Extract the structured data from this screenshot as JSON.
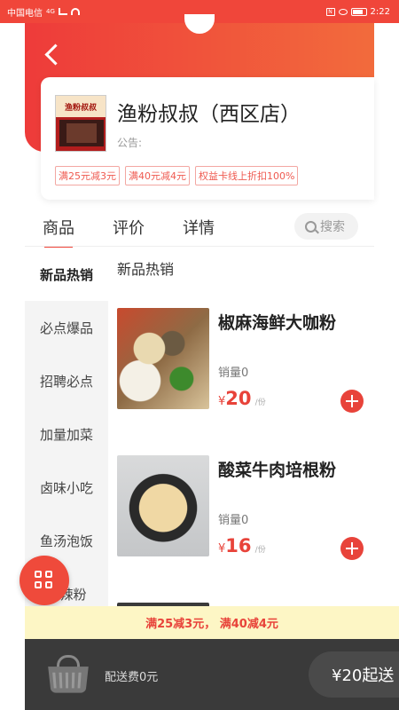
{
  "status_bar": {
    "carrier": "中国电信",
    "network": "4G",
    "time": "2:22"
  },
  "shop": {
    "name": "渔粉叔叔（西区店）",
    "notice_label": "公告:",
    "logo_sign": "渔粉叔叔",
    "promotions": [
      "满25元减3元",
      "满40元减4元",
      "权益卡线上折扣100%"
    ]
  },
  "tabs": {
    "items": [
      "商品",
      "评价",
      "详情"
    ],
    "active": "商品"
  },
  "search": {
    "placeholder": "搜索",
    "icon": "search-icon"
  },
  "categories": {
    "items": [
      "新品热销",
      "必点爆品",
      "招聘必点",
      "加量加菜",
      "卤味小吃",
      "鱼汤泡饭",
      "麻辣粉"
    ],
    "active": "新品热销"
  },
  "section_title": "新品热销",
  "products": [
    {
      "name": "椒麻海鲜大咖粉",
      "sales": "销量0",
      "currency": "¥",
      "price": "20",
      "unit": "/份"
    },
    {
      "name": "酸菜牛肉培根粉",
      "sales": "销量0",
      "currency": "¥",
      "price": "16",
      "unit": "/份"
    }
  ],
  "promo_banner": "满25减3元， 满40减4元",
  "cart": {
    "delivery_fee": "配送费0元",
    "checkout_label": "¥20起送"
  },
  "colors": {
    "accent": "#f0463a",
    "price_red": "#e8433a",
    "banner_bg": "#fdf6c5",
    "cart_bar": "#3a3a3a"
  }
}
